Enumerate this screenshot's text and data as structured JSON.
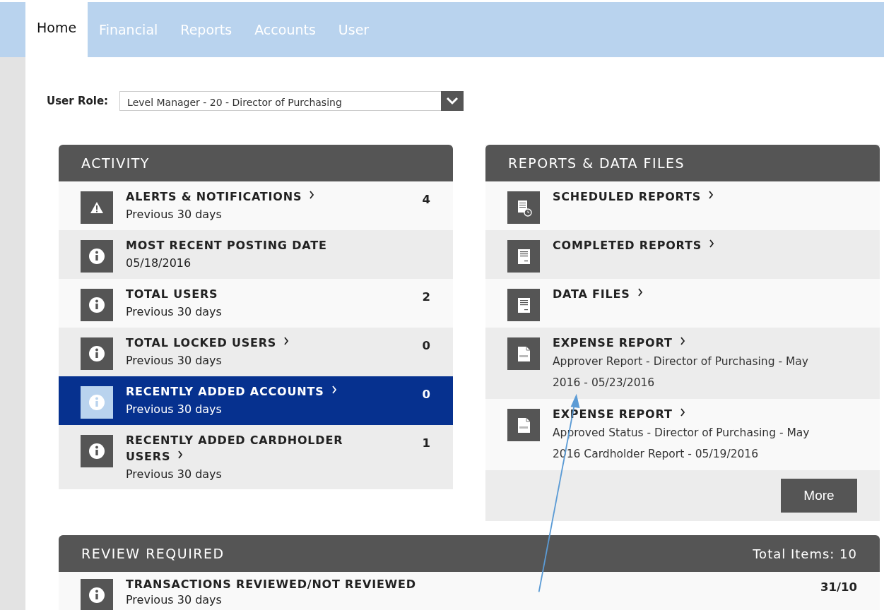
{
  "nav": {
    "tabs": [
      {
        "label": "Home",
        "selected": true
      },
      {
        "label": "Financial",
        "selected": false
      },
      {
        "label": "Reports",
        "selected": false
      },
      {
        "label": "Accounts",
        "selected": false
      },
      {
        "label": "User",
        "selected": false
      }
    ]
  },
  "user_role": {
    "label": "User Role:",
    "value": "Level Manager - 20 - Director of Purchasing"
  },
  "activity": {
    "title": "ACTIVITY",
    "items": [
      {
        "kind": "warning",
        "title": "ALERTS & NOTIFICATIONS",
        "link": true,
        "subtitle": "Previous 30 days",
        "count": "4",
        "selected": false
      },
      {
        "kind": "info",
        "title": "MOST RECENT POSTING DATE",
        "link": false,
        "subtitle": "05/18/2016",
        "selected": false
      },
      {
        "kind": "info",
        "title": "TOTAL USERS",
        "link": false,
        "subtitle": "Previous 30 days",
        "count": "2",
        "selected": false
      },
      {
        "kind": "info",
        "title": "TOTAL LOCKED USERS",
        "link": true,
        "subtitle": "Previous 30 days",
        "count": "0",
        "selected": false
      },
      {
        "kind": "info",
        "title": "RECENTLY ADDED ACCOUNTS",
        "link": true,
        "subtitle": "Previous 30 days",
        "count": "0",
        "selected": true
      },
      {
        "kind": "info",
        "title": "RECENTLY ADDED CARDHOLDER USERS",
        "link": true,
        "subtitle": "Previous 30 days",
        "count": "1",
        "selected": false
      }
    ]
  },
  "reports": {
    "title": "REPORTS & DATA FILES",
    "items": [
      {
        "kind": "scheduled",
        "title": "SCHEDULED REPORTS",
        "link": true
      },
      {
        "kind": "document",
        "title": "COMPLETED REPORTS",
        "link": true
      },
      {
        "kind": "document",
        "title": "DATA FILES",
        "link": true
      },
      {
        "kind": "pdf",
        "title": "EXPENSE REPORT",
        "link": true,
        "description": "Approver Report - Director of Purchasing - May 2016 - 05/23/2016"
      },
      {
        "kind": "pdf",
        "title": "EXPENSE REPORT",
        "link": true,
        "description": "Approved Status - Director of Purchasing - May 2016 Cardholder Report - 05/19/2016"
      }
    ],
    "more_button": "More"
  },
  "review": {
    "title": "REVIEW REQUIRED",
    "total": "Total Items: 10",
    "items": [
      {
        "kind": "info",
        "title": "TRANSACTIONS REVIEWED/NOT REVIEWED",
        "link": false,
        "subtitle": "Previous 30 days",
        "count": "31/10",
        "selected": false
      }
    ]
  }
}
